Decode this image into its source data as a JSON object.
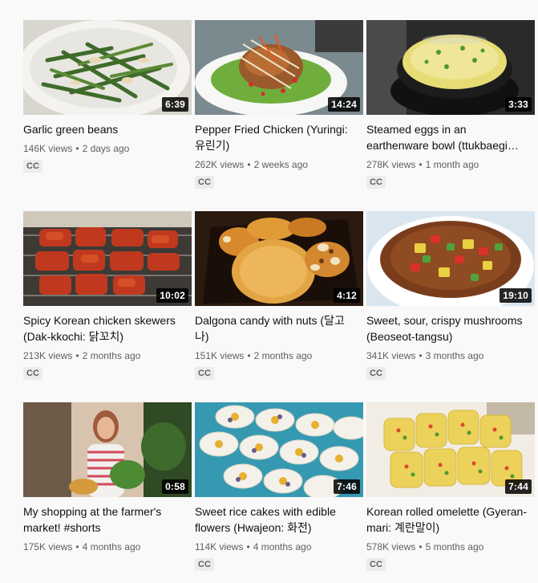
{
  "videos": [
    {
      "title": "Garlic green beans",
      "duration": "6:39",
      "views": "146K views",
      "age": "2 days ago",
      "badge": "CC"
    },
    {
      "title": "Pepper Fried Chicken (Yuringi: 유린기)",
      "duration": "14:24",
      "views": "262K views",
      "age": "2 weeks ago",
      "badge": "CC"
    },
    {
      "title": "Steamed eggs in an earthenware bowl (ttukbaegi gyeran-jjim)",
      "duration": "3:33",
      "views": "278K views",
      "age": "1 month ago",
      "badge": "CC"
    },
    {
      "title": "Spicy Korean chicken skewers (Dak-kkochi: 닭꼬치)",
      "duration": "10:02",
      "views": "213K views",
      "age": "2 months ago",
      "badge": "CC"
    },
    {
      "title": "Dalgona candy with nuts (달고나)",
      "duration": "4:12",
      "views": "151K views",
      "age": "2 months ago",
      "badge": "CC"
    },
    {
      "title": "Sweet, sour, crispy mushrooms (Beoseot-tangsu)",
      "duration": "19:10",
      "views": "341K views",
      "age": "3 months ago",
      "badge": "CC"
    },
    {
      "title": "My shopping at the farmer's market! #shorts",
      "duration": "0:58",
      "views": "175K views",
      "age": "4 months ago",
      "badge": ""
    },
    {
      "title": "Sweet rice cakes with edible flowers (Hwajeon: 화전)",
      "duration": "7:46",
      "views": "114K views",
      "age": "4 months ago",
      "badge": "CC"
    },
    {
      "title": "Korean rolled omelette (Gyeran-mari: 계란말이)",
      "duration": "7:44",
      "views": "578K views",
      "age": "5 months ago",
      "badge": "CC"
    }
  ]
}
